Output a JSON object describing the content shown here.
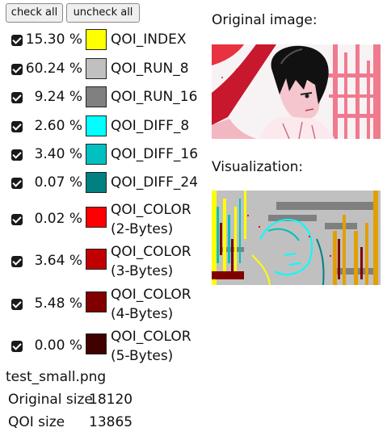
{
  "buttons": {
    "check_all": "check all",
    "uncheck_all": "uncheck all"
  },
  "stats": [
    {
      "pct": "15.30 %",
      "name": "QOI_INDEX",
      "color": "#ffff00"
    },
    {
      "pct": "60.24 %",
      "name": "QOI_RUN_8",
      "color": "#c0c0c0"
    },
    {
      "pct": "9.24 %",
      "name": "QOI_RUN_16",
      "color": "#808080"
    },
    {
      "pct": "2.60 %",
      "name": "QOI_DIFF_8",
      "color": "#00ffff"
    },
    {
      "pct": "3.40 %",
      "name": "QOI_DIFF_16",
      "color": "#00c0c0"
    },
    {
      "pct": "0.07 %",
      "name": "QOI_DIFF_24",
      "color": "#008080"
    },
    {
      "pct": "0.02 %",
      "name": "QOI_COLOR",
      "sub": "(2-Bytes)",
      "color": "#ff0000"
    },
    {
      "pct": "3.64 %",
      "name": "QOI_COLOR",
      "sub": "(3-Bytes)",
      "color": "#c00000"
    },
    {
      "pct": "5.48 %",
      "name": "QOI_COLOR",
      "sub": "(4-Bytes)",
      "color": "#800000"
    },
    {
      "pct": "0.00 %",
      "name": "QOI_COLOR",
      "sub": "(5-Bytes)",
      "color": "#400000"
    }
  ],
  "file": {
    "name": "test_small.png",
    "original_label": "Original size",
    "original_value": "18120",
    "qoi_label": "QOI size",
    "qoi_value": "13865"
  },
  "panels": {
    "original_heading": "Original image:",
    "visualization_heading": "Visualization:"
  }
}
